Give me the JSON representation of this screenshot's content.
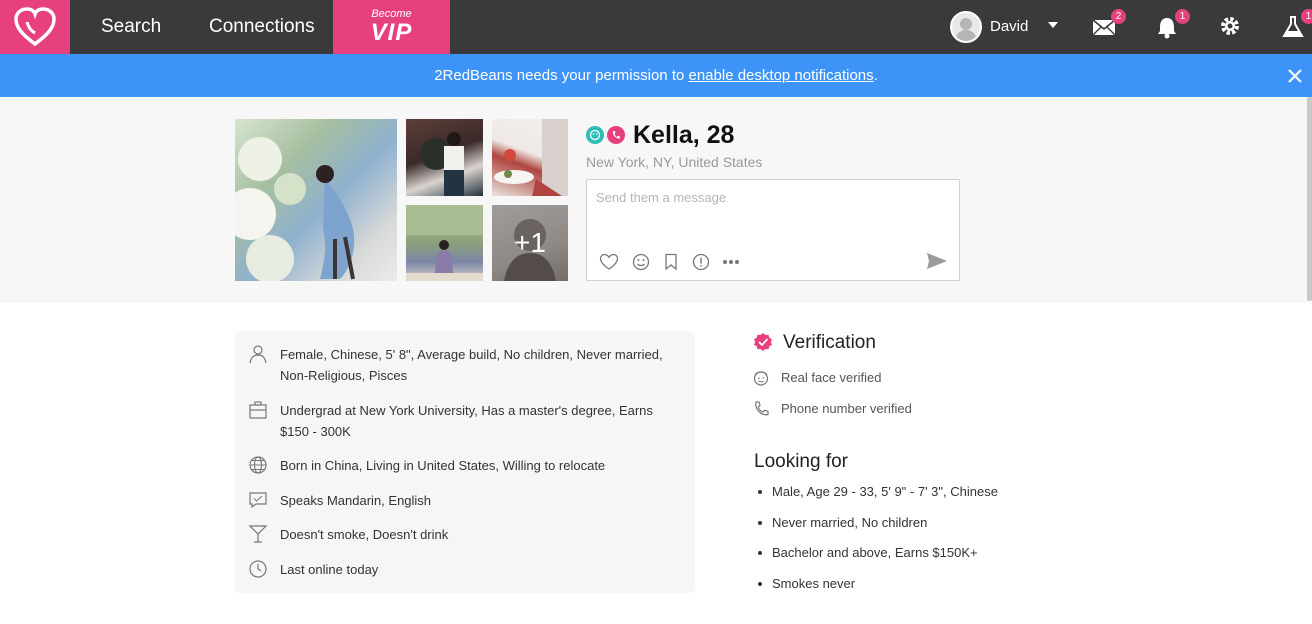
{
  "nav": {
    "search": "Search",
    "connections": "Connections",
    "vip_small": "Become",
    "vip_big": "VIP",
    "user_name": "David",
    "messages_badge": "2",
    "notifications_badge": "1",
    "labs_badge": "1"
  },
  "notification": {
    "prefix": "2RedBeans needs your permission to ",
    "link": "enable desktop notifications",
    "suffix": "."
  },
  "profile": {
    "name": "Kella, 28",
    "location": "New York, NY, United States",
    "more_photos": "+1",
    "message_placeholder": "Send them a message"
  },
  "details": [
    {
      "icon": "person-icon",
      "text": "Female, Chinese, 5' 8\", Average build, No children, Never married, Non-Religious, Pisces"
    },
    {
      "icon": "briefcase-icon",
      "text": "Undergrad at New York University, Has a master's degree, Earns $150 - 300K"
    },
    {
      "icon": "globe-icon",
      "text": "Born in China, Living in United States, Willing to relocate"
    },
    {
      "icon": "speech-icon",
      "text": "Speaks Mandarin, English"
    },
    {
      "icon": "cocktail-icon",
      "text": "Doesn't smoke, Doesn't drink"
    },
    {
      "icon": "clock-icon",
      "text": "Last online today"
    }
  ],
  "verification": {
    "title": "Verification",
    "items": [
      "Real face verified",
      "Phone number verified"
    ]
  },
  "looking_for": {
    "title": "Looking for",
    "items": [
      "Male, Age 29 - 33, 5' 9\" - 7' 3\", Chinese",
      "Never married, No children",
      "Bachelor and above, Earns $150K+",
      "Smokes never"
    ]
  },
  "colors": {
    "brand_pink": "#e6407e",
    "topbar": "#3a3a3a",
    "notification_blue": "#3d94f6",
    "teal": "#2bbfb7"
  }
}
